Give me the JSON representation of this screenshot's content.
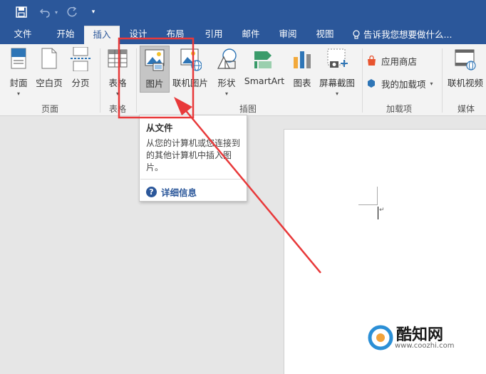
{
  "tabs": [
    {
      "label": "文件"
    },
    {
      "label": "开始"
    },
    {
      "label": "插入"
    },
    {
      "label": "设计"
    },
    {
      "label": "布局"
    },
    {
      "label": "引用"
    },
    {
      "label": "邮件"
    },
    {
      "label": "审阅"
    },
    {
      "label": "视图"
    }
  ],
  "tell_me": "告诉我您想要做什么...",
  "ribbon": {
    "pages_group": {
      "label": "页面",
      "cover": "封面",
      "blank": "空白页",
      "break": "分页"
    },
    "tables_group": {
      "label": "表格",
      "table": "表格"
    },
    "illustrations_group": {
      "label": "插图",
      "picture": "图片",
      "online_picture": "联机图片",
      "shapes": "形状",
      "smartart": "SmartArt",
      "chart": "图表",
      "screenshot": "屏幕截图"
    },
    "addins_group": {
      "label": "加载项",
      "store": "应用商店",
      "my_addins": "我的加载项"
    },
    "media_group": {
      "label": "媒体",
      "online_video": "联机视频"
    }
  },
  "tooltip": {
    "title": "从文件",
    "description": "从您的计算机或您连接到的其他计算机中插入图片。",
    "help": "详细信息"
  },
  "watermark": {
    "brand": "酷知网",
    "url": "www.coozhi.com"
  },
  "colors": {
    "brand": "#2b579a",
    "highlight": "#e8393a"
  }
}
